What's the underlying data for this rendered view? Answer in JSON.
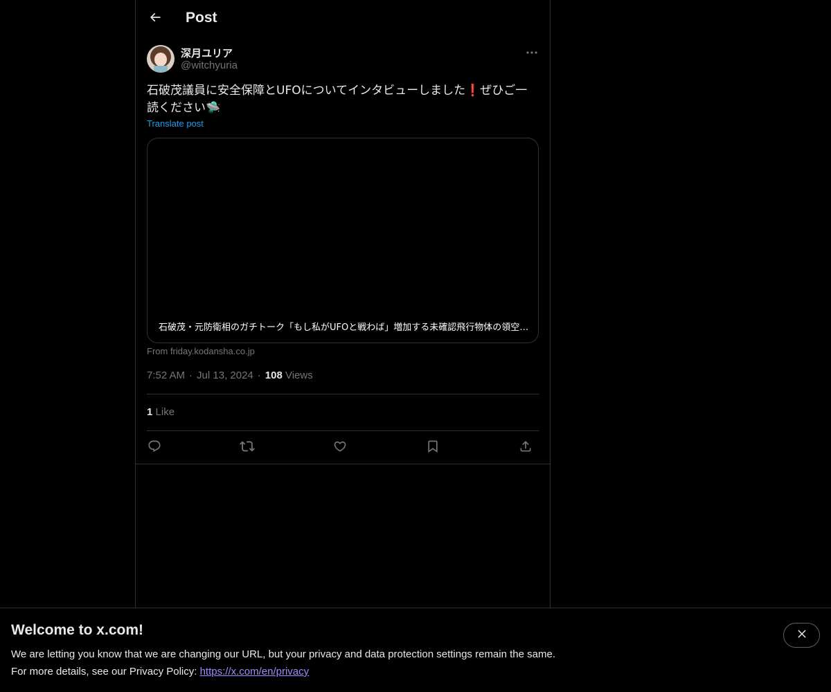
{
  "header": {
    "title": "Post"
  },
  "author": {
    "name": "深月ユリア",
    "handle": "@witchyuria"
  },
  "post": {
    "text": "石破茂議員に安全保障とUFOについてインタビューしました❗️ぜひご一読ください🛸",
    "translate_label": "Translate post",
    "card_title": "石破茂・元防衛相のガチトーク「もし私がUFOと戦わば」増加する未確認飛行物体の領空侵犯にどう対応するか",
    "card_source": "From friday.kodansha.co.jp",
    "time": "7:52 AM",
    "date": "Jul 13, 2024",
    "views_count": "108",
    "views_label": "Views",
    "likes_count": "1",
    "likes_label": "Like"
  },
  "icons": {
    "back": "arrow-left-icon",
    "more": "more-horizontal-icon",
    "reply": "reply-icon",
    "repost": "repost-icon",
    "like": "heart-icon",
    "bookmark": "bookmark-icon",
    "share": "share-icon",
    "close": "close-icon"
  },
  "banner": {
    "title": "Welcome to x.com!",
    "line1": "We are letting you know that we are changing our URL, but your privacy and data protection settings remain the same.",
    "line2_prefix": "For more details, see our Privacy Policy: ",
    "link": "https://x.com/en/privacy"
  },
  "colors": {
    "background": "#000000",
    "accent": "#1d9bf0",
    "muted": "#71767b",
    "border": "#2f3336"
  }
}
